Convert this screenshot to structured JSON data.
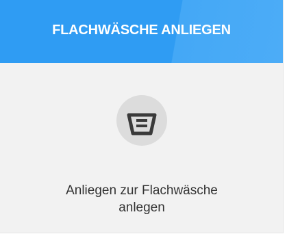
{
  "tile": {
    "title": "FLACHWÄSCHE ANLIEGEN",
    "text_line1": "Anliegen zur Flachwäsche",
    "text_line2": "anlegen",
    "icon": "laundry-basket-icon",
    "accent_color": "#2f9cf3",
    "icon_color": "#3a3a3a"
  }
}
